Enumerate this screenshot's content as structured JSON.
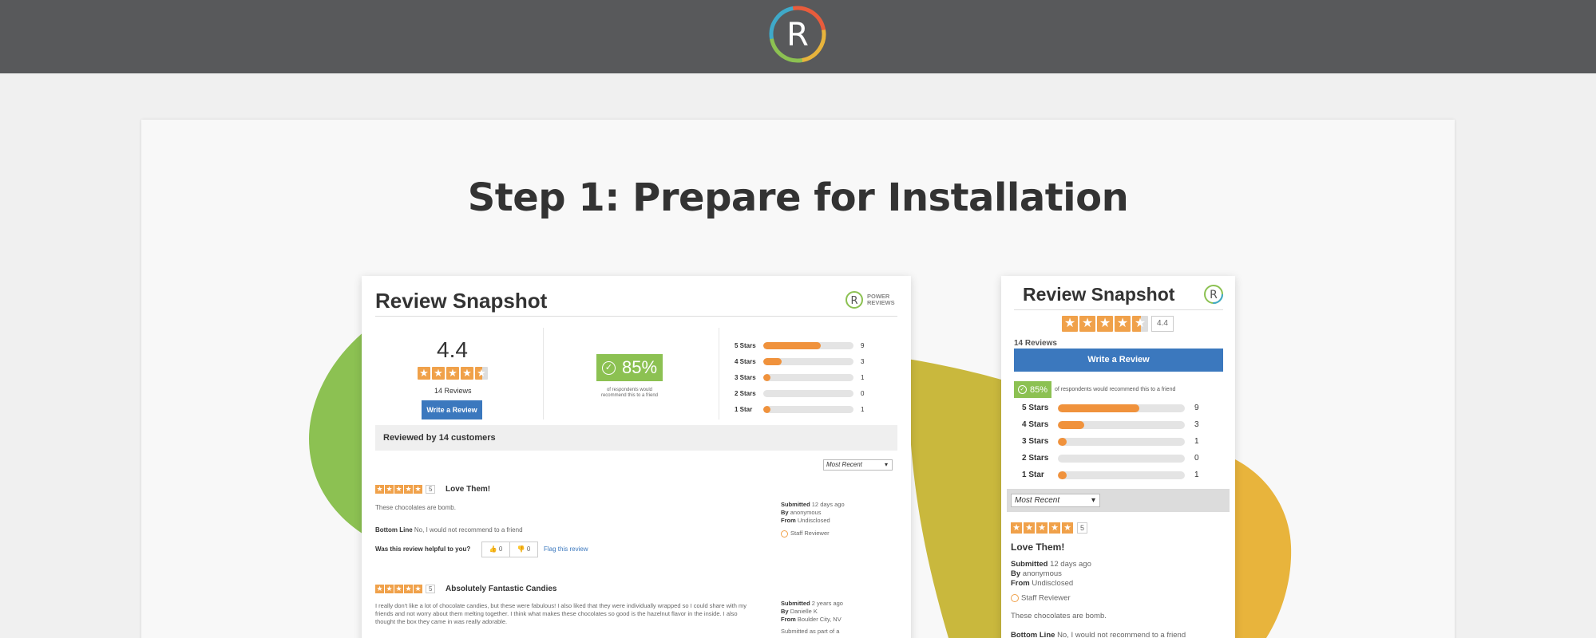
{
  "header": {
    "logo_letter": "R"
  },
  "step_title": "Step 1: Prepare for Installation",
  "colors": {
    "topbar": "#58595b",
    "green_blob": "#8cc152",
    "olive_blob": "#c9b83d",
    "gold_blob": "#e8b43c",
    "star_orange": "#f0a14a",
    "button_blue": "#3b78be",
    "recommend_green": "#8cc152"
  },
  "desktop": {
    "title": "Review Snapshot",
    "logo_text_1": "POWER",
    "logo_text_2": "REVIEWS",
    "average": "4.4",
    "rating": 4.4,
    "review_count": "14 Reviews",
    "write_review": "Write a Review",
    "recommend_pct": "85%",
    "recommend_text_1": "of respondents would",
    "recommend_text_2": "recommend this to a friend",
    "histogram": [
      {
        "label": "5 Stars",
        "count": "9",
        "fraction": 0.64
      },
      {
        "label": "4 Stars",
        "count": "3",
        "fraction": 0.2
      },
      {
        "label": "3 Stars",
        "count": "1",
        "fraction": 0.06
      },
      {
        "label": "2 Stars",
        "count": "0",
        "fraction": 0
      },
      {
        "label": "1 Star",
        "count": "1",
        "fraction": 0.06
      }
    ],
    "reviewed_by_prefix": "Reviewed by ",
    "reviewed_by_count": "14 customers",
    "sort": "Most Recent",
    "reviews": [
      {
        "score": "5",
        "headline": "Love Them!",
        "body": "These chocolates are bomb.",
        "bottom_line_label": "Bottom Line",
        "bottom_line": "No, I would not recommend to a friend",
        "helpful_q": "Was this review helpful to you?",
        "up": "0",
        "down": "0",
        "flag": "Flag this review",
        "submitted_label": "Submitted",
        "submitted": "12 days ago",
        "by_label": "By",
        "by": "anonymous",
        "from_label": "From",
        "from": "Undisclosed",
        "badge": "Staff Reviewer"
      },
      {
        "score": "5",
        "headline": "Absolutely Fantastic Candies",
        "body": "I really don't like a lot of chocolate candies, but these were fabulous! I also liked that they were individually wrapped so I could share with my friends and not worry about them melting together. I think what makes these chocolates so good is the hazelnut flavor in the inside. I also thought the box they came in was really adorable.",
        "submitted_label": "Submitted",
        "submitted": "2 years ago",
        "by_label": "By",
        "by": "Danielle K",
        "from_label": "From",
        "from": "Boulder City, NV",
        "extra": "Submitted as part of a"
      }
    ]
  },
  "mobile": {
    "title": "Review Snapshot",
    "average": "4.4",
    "review_count": "14 Reviews",
    "write_review": "Write a Review",
    "recommend_pct": "85%",
    "recommend_text": "of respondents would recommend this to a friend",
    "histogram": [
      {
        "label": "5 Stars",
        "count": "9",
        "fraction": 0.64
      },
      {
        "label": "4 Stars",
        "count": "3",
        "fraction": 0.21
      },
      {
        "label": "3 Stars",
        "count": "1",
        "fraction": 0.07
      },
      {
        "label": "2 Stars",
        "count": "0",
        "fraction": 0
      },
      {
        "label": "1 Star",
        "count": "1",
        "fraction": 0.07
      }
    ],
    "sort": "Most Recent",
    "score": "5",
    "headline": "Love Them!",
    "submitted_label": "Submitted",
    "submitted": "12 days ago",
    "by_label": "By",
    "by": "anonymous",
    "from_label": "From",
    "from": "Undisclosed",
    "badge": "Staff Reviewer",
    "body": "These chocolates are bomb.",
    "bottom_line_label": "Bottom Line",
    "bottom_line": "No, I would not recommend to a friend"
  }
}
